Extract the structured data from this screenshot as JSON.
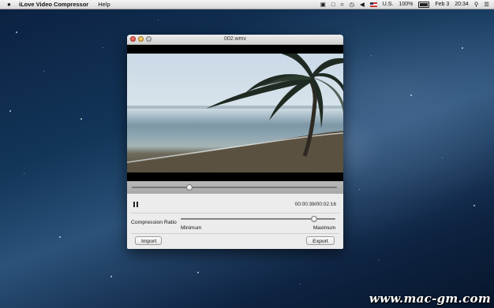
{
  "menubar": {
    "app_name": "iLove Video Compressor",
    "help_label": "Help",
    "input_source": "U.S.",
    "battery": "100%",
    "date": "Feb 3",
    "time": "20:34"
  },
  "window": {
    "title": "002.wmv",
    "playback_progress": 0.28,
    "time_display": "00:00:38/00:02:16",
    "compression_label": "Compression Ratio",
    "compression_value": 0.86,
    "minimum_label": "Minimum",
    "maximum_label": "Maximum",
    "import_label": "Import",
    "export_label": "Export"
  },
  "watermark": "www.mac-gm.com"
}
